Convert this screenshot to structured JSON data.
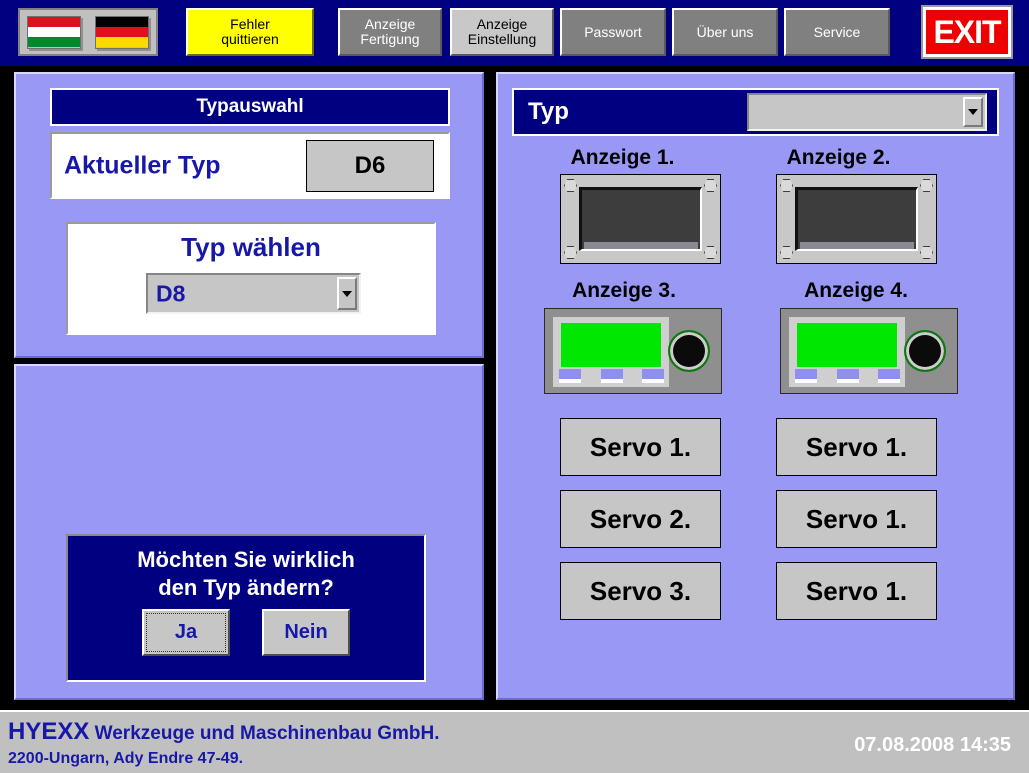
{
  "toolbar": {
    "flags": [
      {
        "name": "hungary-flag",
        "label": "Ungarn"
      },
      {
        "name": "germany-flag",
        "label": "Deutschland"
      }
    ],
    "buttons": [
      {
        "label_line1": "Fehler",
        "label_line2": "quittieren",
        "style": "yellow"
      },
      {
        "label_line1": "Anzeige",
        "label_line2": "Fertigung",
        "style": "gray-dark"
      },
      {
        "label_line1": "Anzeige",
        "label_line2": "Einstellung",
        "style": "gray-light"
      },
      {
        "label_line1": "Passwort",
        "label_line2": "",
        "style": "gray-dark"
      },
      {
        "label_line1": "Über uns",
        "label_line2": "",
        "style": "gray-dark"
      },
      {
        "label_line1": "Service",
        "label_line2": "",
        "style": "gray-dark"
      }
    ],
    "exit_label": "EXIT"
  },
  "left_panel": {
    "header": "Typauswahl",
    "current_type_label": "Aktueller Typ",
    "current_type_value": "D6",
    "select_type_label": "Typ wählen",
    "select_type_value": "D8"
  },
  "confirm": {
    "line1": "Möchten Sie wirklich",
    "line2": "den Typ ändern?",
    "yes_label": "Ja",
    "no_label": "Nein"
  },
  "right_panel": {
    "header_label": "Typ",
    "header_combo_value": "",
    "displays": [
      {
        "label": "Anzeige 1.",
        "kind": "dark"
      },
      {
        "label": "Anzeige 2.",
        "kind": "dark"
      },
      {
        "label": "Anzeige 3.",
        "kind": "green"
      },
      {
        "label": "Anzeige 4.",
        "kind": "green"
      }
    ],
    "servos_left": [
      "Servo 1.",
      "Servo 2.",
      "Servo 3."
    ],
    "servos_right": [
      "Servo 1.",
      "Servo 1.",
      "Servo 1."
    ]
  },
  "footer": {
    "company_name": "HYEXX",
    "company_desc": " Werkzeuge und Maschinenbau GmbH.",
    "company_address": "2200-Ungarn, Ady Endre 47-49.",
    "datetime": "07.08.2008 14:35"
  },
  "colors": {
    "window_background": "#000000",
    "toolbar_background": "#000080",
    "panel_background": "#9999f5",
    "header_navy": "#000080",
    "accent_text": "#1818a8",
    "alarm_yellow": "#ffff00",
    "exit_red": "#ee0000",
    "lcd_green": "#00e800",
    "footer_background": "#c0c0c0"
  }
}
